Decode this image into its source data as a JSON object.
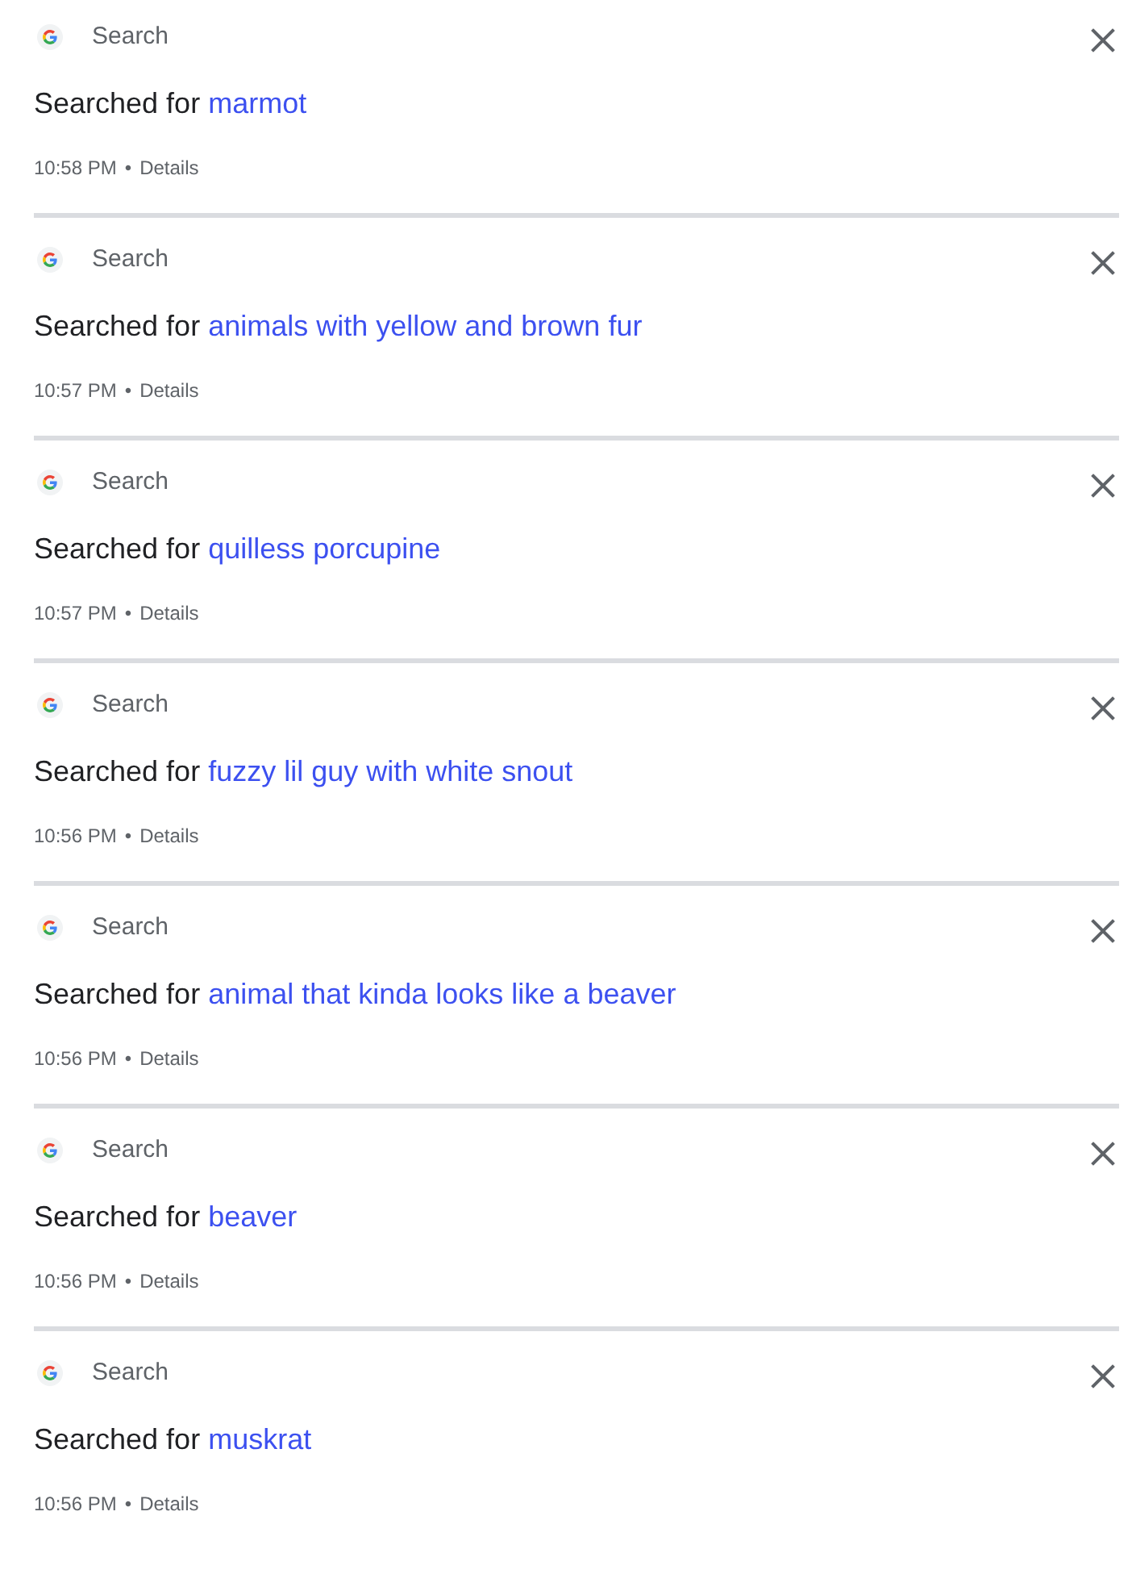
{
  "items": [
    {
      "source": "Search",
      "prefix": "Searched for",
      "query": "marmot",
      "time": "10:58 PM",
      "separator": "•",
      "details": "Details"
    },
    {
      "source": "Search",
      "prefix": "Searched for",
      "query": "animals with yellow and brown fur",
      "time": "10:57 PM",
      "separator": "•",
      "details": "Details"
    },
    {
      "source": "Search",
      "prefix": "Searched for",
      "query": "quilless porcupine",
      "time": "10:57 PM",
      "separator": "•",
      "details": "Details"
    },
    {
      "source": "Search",
      "prefix": "Searched for",
      "query": "fuzzy lil guy with white snout",
      "time": "10:56 PM",
      "separator": "•",
      "details": "Details"
    },
    {
      "source": "Search",
      "prefix": "Searched for",
      "query": "animal that kinda looks like a beaver",
      "time": "10:56 PM",
      "separator": "•",
      "details": "Details"
    },
    {
      "source": "Search",
      "prefix": "Searched for",
      "query": "beaver",
      "time": "10:56 PM",
      "separator": "•",
      "details": "Details"
    },
    {
      "source": "Search",
      "prefix": "Searched for",
      "query": "muskrat",
      "time": "10:56 PM",
      "separator": "•",
      "details": "Details"
    }
  ]
}
